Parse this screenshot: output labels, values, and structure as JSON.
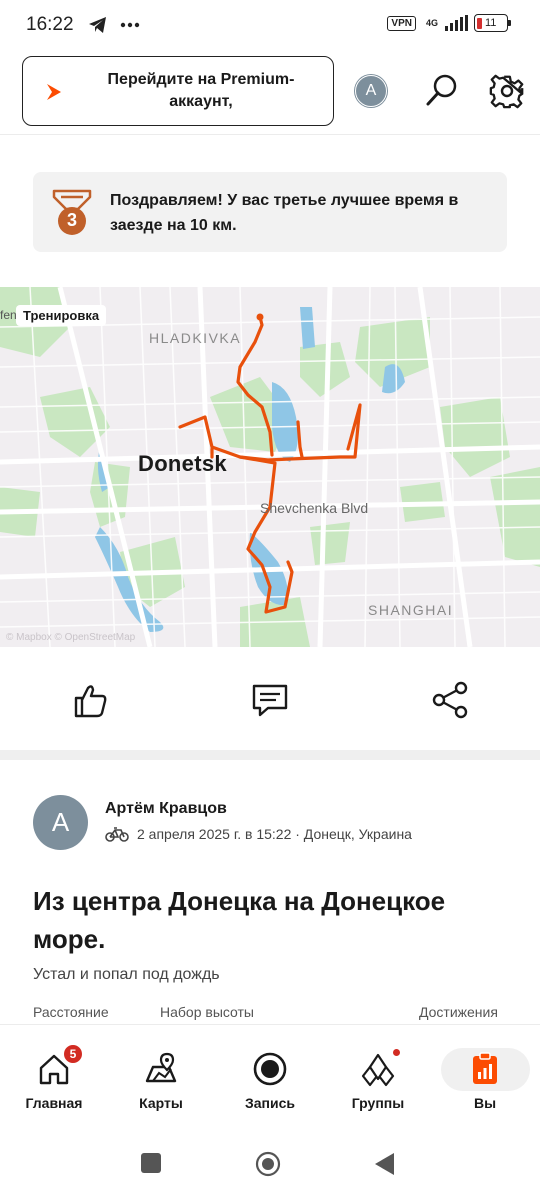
{
  "status_bar": {
    "time": "16:22",
    "vpn": "VPN",
    "network": "4G",
    "battery": "11"
  },
  "header": {
    "premium_banner": "Перейдите на Premium-аккаунт,",
    "avatar_initial": "A"
  },
  "achievement": {
    "rank": "3",
    "text": "Поздравляем! У вас третье лучшее время в заезде на 10 км."
  },
  "map": {
    "tag_stub": "fen",
    "tag": "Тренировка",
    "city": "Donetsk",
    "districts": [
      "HLADKIVKA",
      "SHANGHAI"
    ],
    "street": "Shevchenka Blvd",
    "route_color": "#e8500c",
    "attribution": "© Mapbox © OpenStreetMap"
  },
  "activity": {
    "avatar_initial": "A",
    "athlete": "Артём Кравцов",
    "meta": "2 апреля 2025 г. в 15:22 · Донецк, Украина",
    "sport_icon": "bike-icon",
    "title": "Из центра Донецка на Донецкое море.",
    "description": "Устал и попал под дождь",
    "stats_labels": [
      "Расстояние",
      "Набор высоты",
      "Достижения"
    ]
  },
  "bottom_nav": {
    "items": [
      {
        "label": "Главная",
        "icon": "home-icon",
        "badge": "5"
      },
      {
        "label": "Карты",
        "icon": "map-icon"
      },
      {
        "label": "Запись",
        "icon": "record-icon"
      },
      {
        "label": "Группы",
        "icon": "groups-icon"
      },
      {
        "label": "Вы",
        "icon": "you-icon"
      }
    ]
  },
  "colors": {
    "accent": "#fc4c02",
    "badge": "#d22b22",
    "bronze": "#c0602a"
  }
}
